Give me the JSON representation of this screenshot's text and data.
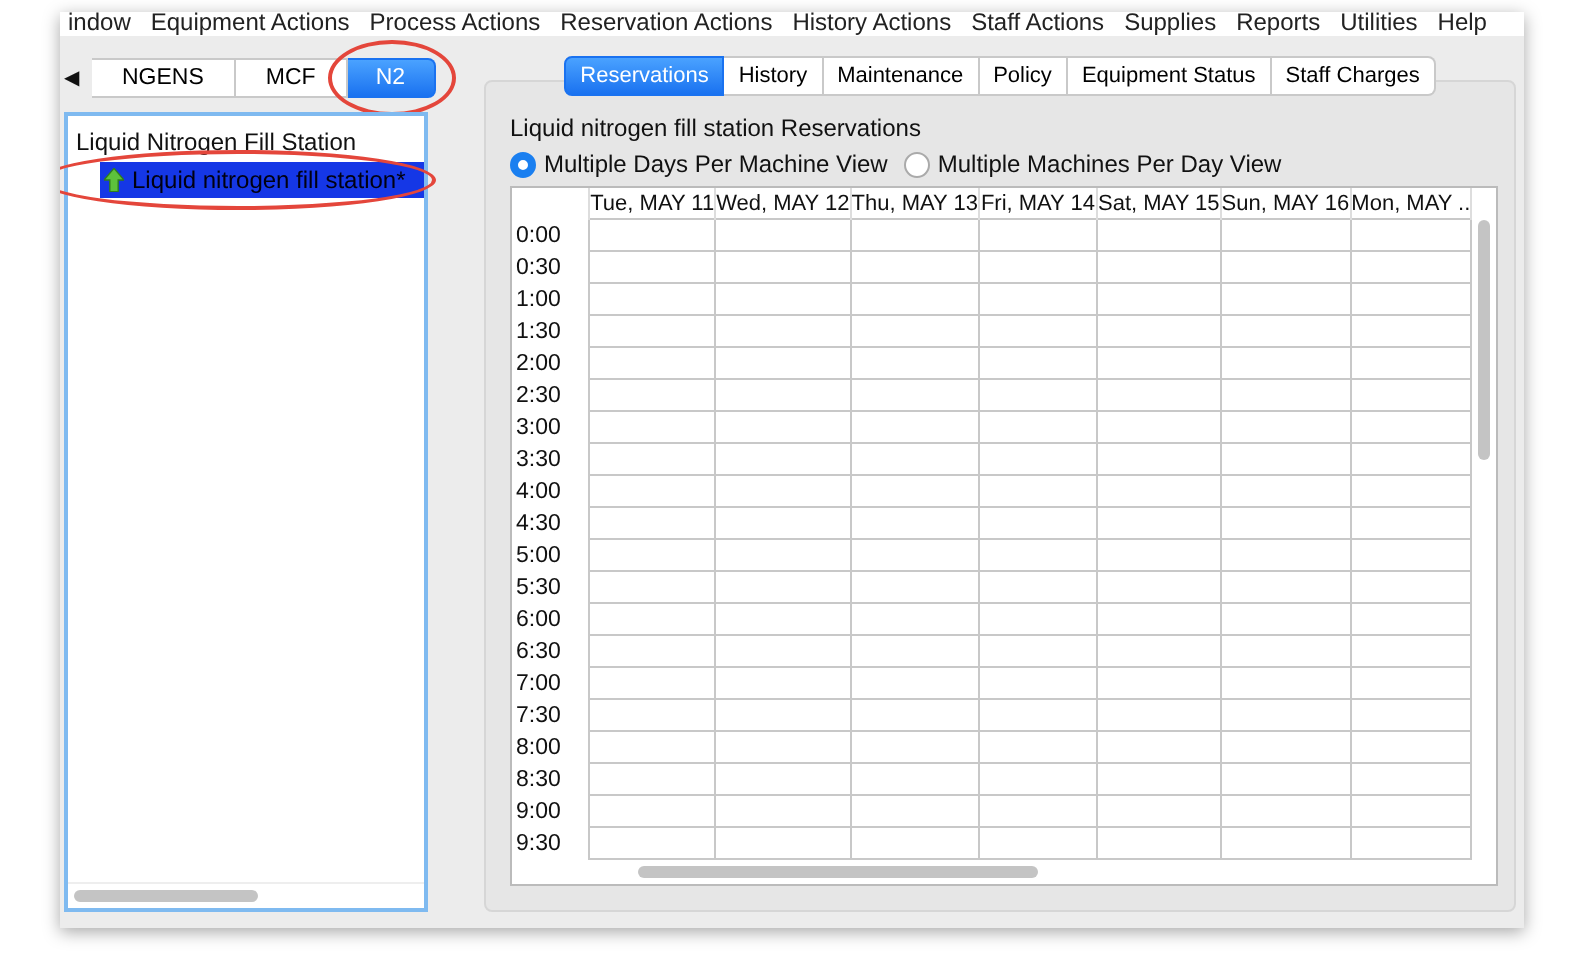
{
  "menu": [
    "indow",
    "Equipment Actions",
    "Process Actions",
    "Reservation Actions",
    "History Actions",
    "Staff Actions",
    "Supplies",
    "Reports",
    "Utilities",
    "Help"
  ],
  "site_tabs": {
    "scroll_arrow": "◀",
    "tabs": [
      {
        "label": "NGENS",
        "selected": false,
        "circled": false
      },
      {
        "label": "MCF",
        "selected": false,
        "circled": false
      },
      {
        "label": "N2",
        "selected": true,
        "circled": true
      }
    ]
  },
  "tree": {
    "heading": "Liquid Nitrogen Fill Station",
    "items": [
      {
        "label": "Liquid nitrogen fill station*",
        "selected": true,
        "circled": true
      }
    ]
  },
  "tabs": [
    {
      "label": "Reservations",
      "selected": true
    },
    {
      "label": "History",
      "selected": false
    },
    {
      "label": "Maintenance",
      "selected": false
    },
    {
      "label": "Policy",
      "selected": false
    },
    {
      "label": "Equipment Status",
      "selected": false
    },
    {
      "label": "Staff Charges",
      "selected": false
    }
  ],
  "reservations": {
    "title": "Liquid nitrogen fill station Reservations",
    "views": [
      {
        "label": "Multiple Days Per Machine View",
        "selected": true
      },
      {
        "label": "Multiple Machines Per Day View",
        "selected": false
      }
    ],
    "columns": [
      "Tue, MAY 11",
      "Wed, MAY 12",
      "Thu, MAY 13",
      "Fri, MAY 14",
      "Sat, MAY 15",
      "Sun, MAY 16",
      "Mon, MAY .."
    ],
    "times": [
      "0:00",
      "0:30",
      "1:00",
      "1:30",
      "2:00",
      "2:30",
      "3:00",
      "3:30",
      "4:00",
      "4:30",
      "5:00",
      "5:30",
      "6:00",
      "6:30",
      "7:00",
      "7:30",
      "8:00",
      "8:30",
      "9:00",
      "9:30"
    ]
  }
}
